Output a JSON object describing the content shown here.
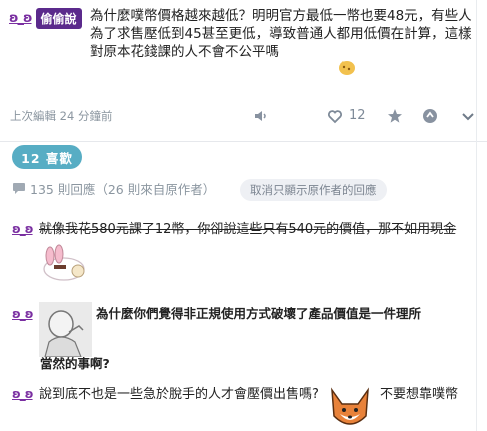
{
  "post": {
    "author": "ʚ_ʚ",
    "author_badge": "偷偷說",
    "text": "為什麼噗幣價格越來越低？明明官方最低一幣也要48元，有些人為了求售壓低到45甚至更低，導致普通人都用低價在計算，這樣對原本花錢課的人不會不公平嗎",
    "edited": "上次編輯 24 分鐘前",
    "like_count": "12"
  },
  "summary": {
    "likes_label": "12 喜歡",
    "reply_count": "135 則回應（26 則來自原作者）",
    "filter_button": "取消只顯示原作者的回應"
  },
  "comments": [
    {
      "author": "ʚ_ʚ",
      "text": "就像我花580元課了12幣，你卻說這些只有540元的價值，那不如用現金"
    },
    {
      "author": "ʚ_ʚ",
      "text_line1": "為什麼你們覺得非正規使用方式破壞了產品價值是一件理所",
      "text_line2": "當然的事啊?"
    },
    {
      "author": "ʚ_ʚ",
      "text": "說到底不也是一些急於脫手的人才會壓價出售嗎?",
      "text_tail": "不要想靠噗幣"
    }
  ],
  "colors": {
    "accent_teal": "#57adc4",
    "author_purple": "#7a2fa1",
    "badge_purple": "#5b2a8c",
    "muted": "#8b96a0"
  },
  "icons": [
    "mute-icon",
    "heart-icon",
    "star-icon",
    "replurk-icon",
    "chevron-down-icon",
    "chat-bubble-icon"
  ]
}
